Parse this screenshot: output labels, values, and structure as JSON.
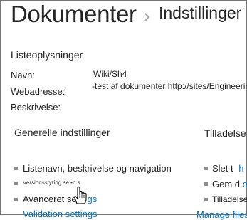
{
  "header": {
    "title": "Dokumenter",
    "subtitle": "Indstillinger"
  },
  "list_info": {
    "heading": "Listeoplysninger",
    "fields": [
      {
        "label": "Navn:",
        "value": "Wiki/Sh4"
      },
      {
        "label": "Webadresse:",
        "value": "-test af dokumenter http://sites/Engineering"
      },
      {
        "label": "Beskrivelse:",
        "value": ""
      }
    ]
  },
  "general_settings": {
    "heading": "Generelle indstillinger",
    "items": [
      {
        "label": "Listenavn, beskrivelse og navigation"
      },
      {
        "label": "Versionsstyring se •n s"
      },
      {
        "label": "Avanceret se",
        "link_fragment": "t gs"
      },
      {
        "label": "Validation settings"
      }
    ]
  },
  "permissions": {
    "heading": "Tilladelse",
    "items": [
      {
        "label": "Slet t",
        "link_fragment": "h"
      },
      {
        "label": "Gem d",
        "link_fragment": "oc"
      },
      {
        "label": "Tilladelse",
        "link_fragment": "ce"
      },
      {
        "label": "Manage files"
      }
    ]
  },
  "colors": {
    "link": "#0072c6",
    "text": "#222222",
    "bullet": "#8a8a8a"
  },
  "icons": {
    "breadcrumb_separator": "chevron-right-icon",
    "pointer": "hand-pointer-icon"
  }
}
